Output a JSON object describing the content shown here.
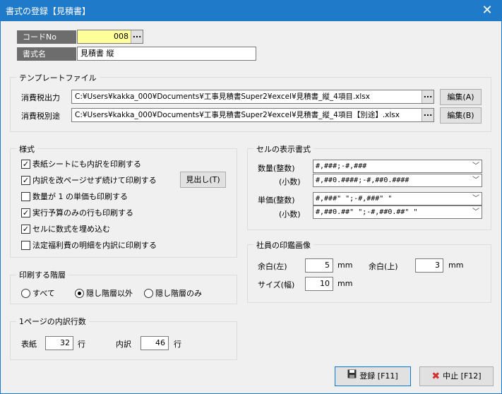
{
  "window": {
    "title": "書式の登録【見積書】"
  },
  "code": {
    "label": "コードNo",
    "value": "008"
  },
  "format_name": {
    "label": "書式名",
    "value": "見積書 縦"
  },
  "template": {
    "group_title": "テンプレートファイル",
    "tax_out_label": "消費税出力",
    "tax_out_path": "C:¥Users¥kakka_000¥Documents¥工事見積書Super2¥excel¥見積書_縦_4項目.xlsx",
    "tax_out_edit": "編集(A)",
    "tax_sep_label": "消費税別途",
    "tax_sep_path": "C:¥Users¥kakka_000¥Documents¥工事見積書Super2¥excel¥見積書_縦_4項目【別途】.xlsx",
    "tax_sep_edit": "編集(B)",
    "dots": "..."
  },
  "style": {
    "group_title": "様式",
    "options": [
      {
        "label": "表紙シートにも内訳を印刷する",
        "checked": true
      },
      {
        "label": "内訳を改ページせず続けて印刷する",
        "checked": true
      },
      {
        "label": "数量が 1 の単価も印刷する",
        "checked": false
      },
      {
        "label": "実行予算のみの行も印刷する",
        "checked": true
      },
      {
        "label": "セルに数式を埋め込む",
        "checked": true
      },
      {
        "label": "法定福利費の明細を内訳に印刷する",
        "checked": false
      }
    ],
    "heading_button": "見出し(T)"
  },
  "print_level": {
    "group_title": "印刷する階層",
    "options": [
      {
        "label": "すべて",
        "selected": false
      },
      {
        "label": "隠し階層以外",
        "selected": true
      },
      {
        "label": "隠し階層のみ",
        "selected": false
      }
    ]
  },
  "rows_per_page": {
    "group_title": "1ページの内訳行数",
    "cover_label": "表紙",
    "cover_value": "32",
    "cover_unit": "行",
    "detail_label": "内訳",
    "detail_value": "46",
    "detail_unit": "行"
  },
  "cell_format": {
    "group_title": "セルの表示書式",
    "qty_int_label": "数量(整数)",
    "qty_int_value": "#,###;-#,###",
    "qty_dec_label": "(小数)",
    "qty_dec_value": "#,##0.####;-#,##0.####",
    "price_int_label": "単価(整数)",
    "price_int_value": "#,###\" \";-#,###\" \"",
    "price_dec_label": "(小数)",
    "price_dec_value": "#,##0.##\" \";-#,##0.##\" \""
  },
  "seal": {
    "group_title": "社員の印鑑画像",
    "margin_left_label": "余白(左)",
    "margin_left_value": "5",
    "margin_top_label": "余白(上)",
    "margin_top_value": "3",
    "size_label": "サイズ(幅)",
    "size_value": "10",
    "unit": "mm"
  },
  "footer": {
    "register_label": "登録 [F11]",
    "cancel_label": "中止 [F12]"
  },
  "colors": {
    "titlebar": "#1f7ac9",
    "label_bg": "#6d6d6d",
    "code_input_bg": "#ffff99",
    "cancel_icon": "#d32f2f"
  },
  "icons": {
    "close": "close-icon",
    "checkmark": "check-icon",
    "save": "floppy-disk-icon",
    "cancel": "x-mark-icon",
    "dropdown": "chevron-down-icon"
  }
}
